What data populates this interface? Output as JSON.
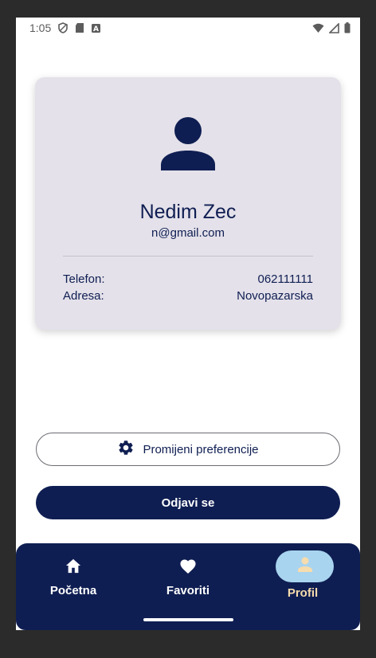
{
  "status_bar": {
    "time": "1:05",
    "icons": [
      "shield-icon",
      "sd-card-icon",
      "a-badge-icon",
      "wifi-icon",
      "signal-icon",
      "battery-icon"
    ]
  },
  "profile": {
    "name": "Nedim Zec",
    "email": "n@gmail.com",
    "phone_label": "Telefon:",
    "phone_value": "062111111",
    "address_label": "Adresa:",
    "address_value": "Novopazarska",
    "avatar_icon": "person-icon"
  },
  "actions": {
    "preferences_label": "Promijeni preferencije",
    "preferences_icon": "gear-icon",
    "logout_label": "Odjavi se"
  },
  "bottom_nav": {
    "items": [
      {
        "label": "Početna",
        "icon": "home-icon",
        "active": false
      },
      {
        "label": "Favoriti",
        "icon": "heart-icon",
        "active": false
      },
      {
        "label": "Profil",
        "icon": "person-icon",
        "active": true
      }
    ]
  },
  "colors": {
    "primary": "#0f1e52",
    "card_bg": "#e4e1ea",
    "active_pill": "#a9d4ef",
    "active_label": "#f7dcad"
  }
}
